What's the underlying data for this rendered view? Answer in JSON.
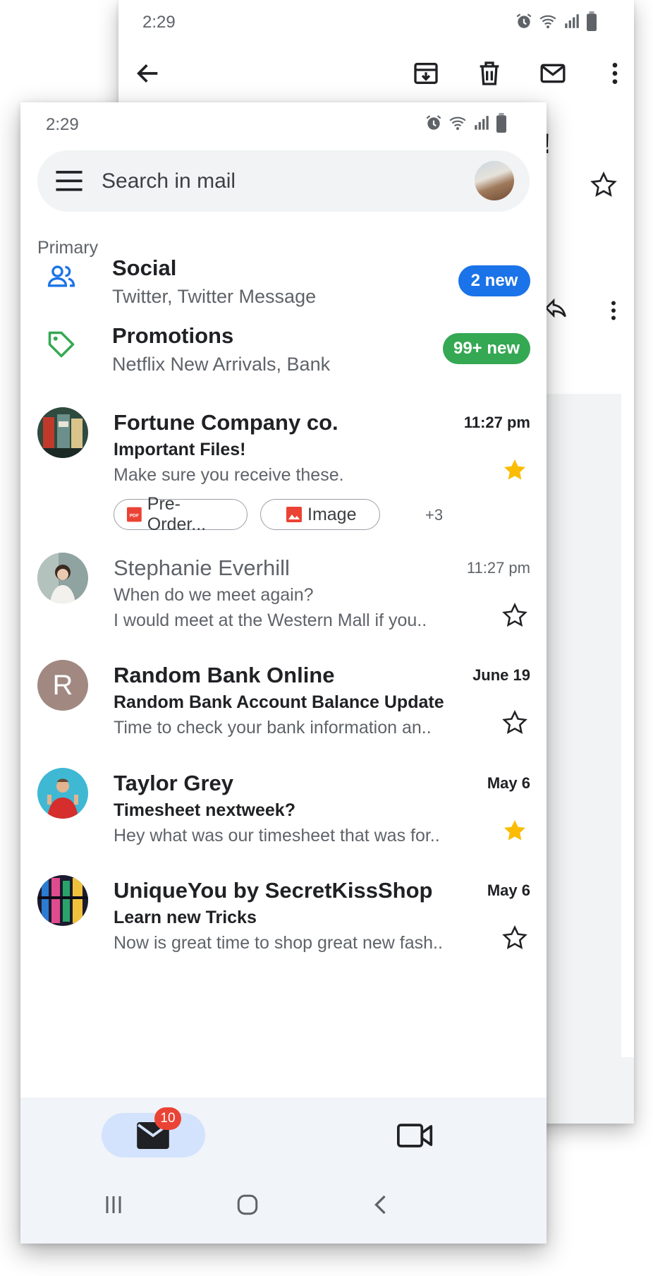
{
  "back_screen": {
    "status_time": "2:29",
    "partial_title": "!",
    "toolbar_icons": [
      "back-arrow-icon",
      "archive-icon",
      "delete-icon",
      "mark-unread-icon",
      "more-vert-icon"
    ]
  },
  "status_bar": {
    "time": "2:29",
    "icons": [
      "alarm-icon",
      "wifi-icon",
      "signal-icon",
      "battery-icon"
    ]
  },
  "search": {
    "placeholder": "Search in mail"
  },
  "section": {
    "label": "Primary"
  },
  "categories": [
    {
      "title": "Social",
      "subtitle": "Twitter, Twitter Message",
      "badge": "2 new",
      "badge_color": "#1a73e8",
      "icon": "people-icon"
    },
    {
      "title": "Promotions",
      "subtitle": "Netflix New Arrivals, Bank",
      "badge": "99+ new",
      "badge_color": "#34a853",
      "icon": "tag-icon"
    }
  ],
  "emails": [
    {
      "sender": "Fortune Company co.",
      "time": "11:27 pm",
      "subject": "Important Files!",
      "snippet": "Make sure you receive these.",
      "starred": true,
      "unread": true,
      "attachments": [
        {
          "label": "Pre-Order...",
          "icon": "pdf-icon"
        },
        {
          "label": "Image",
          "icon": "image-icon"
        }
      ],
      "more_attachments": "+3"
    },
    {
      "sender": "Stephanie Everhill",
      "time": "11:27 pm",
      "subject": "When do we meet again?",
      "snippet": "I would meet at the Western Mall if you..",
      "starred": false,
      "unread": false
    },
    {
      "sender": "Random Bank Online",
      "time": "June 19",
      "subject": "Random Bank Account Balance Update",
      "snippet": "Time to check your bank information an..",
      "starred": false,
      "unread": true,
      "avatar_letter": "R"
    },
    {
      "sender": "Taylor Grey",
      "time": "May 6",
      "subject": "Timesheet nextweek?",
      "snippet": "Hey what was our timesheet that was for..",
      "starred": true,
      "unread": true
    },
    {
      "sender": "UniqueYou by SecretKissShop",
      "time": "May 6",
      "subject": "Learn new Tricks",
      "snippet": "Now is great time to shop great new fash..",
      "starred": false,
      "unread": true
    }
  ],
  "bottom_nav": {
    "mail_badge": "10",
    "items": [
      "mail-icon",
      "video-icon"
    ]
  },
  "colors": {
    "accent_blue": "#1a73e8",
    "accent_green": "#34a853",
    "star_yellow": "#fbbc04",
    "badge_red": "#ea4335"
  }
}
